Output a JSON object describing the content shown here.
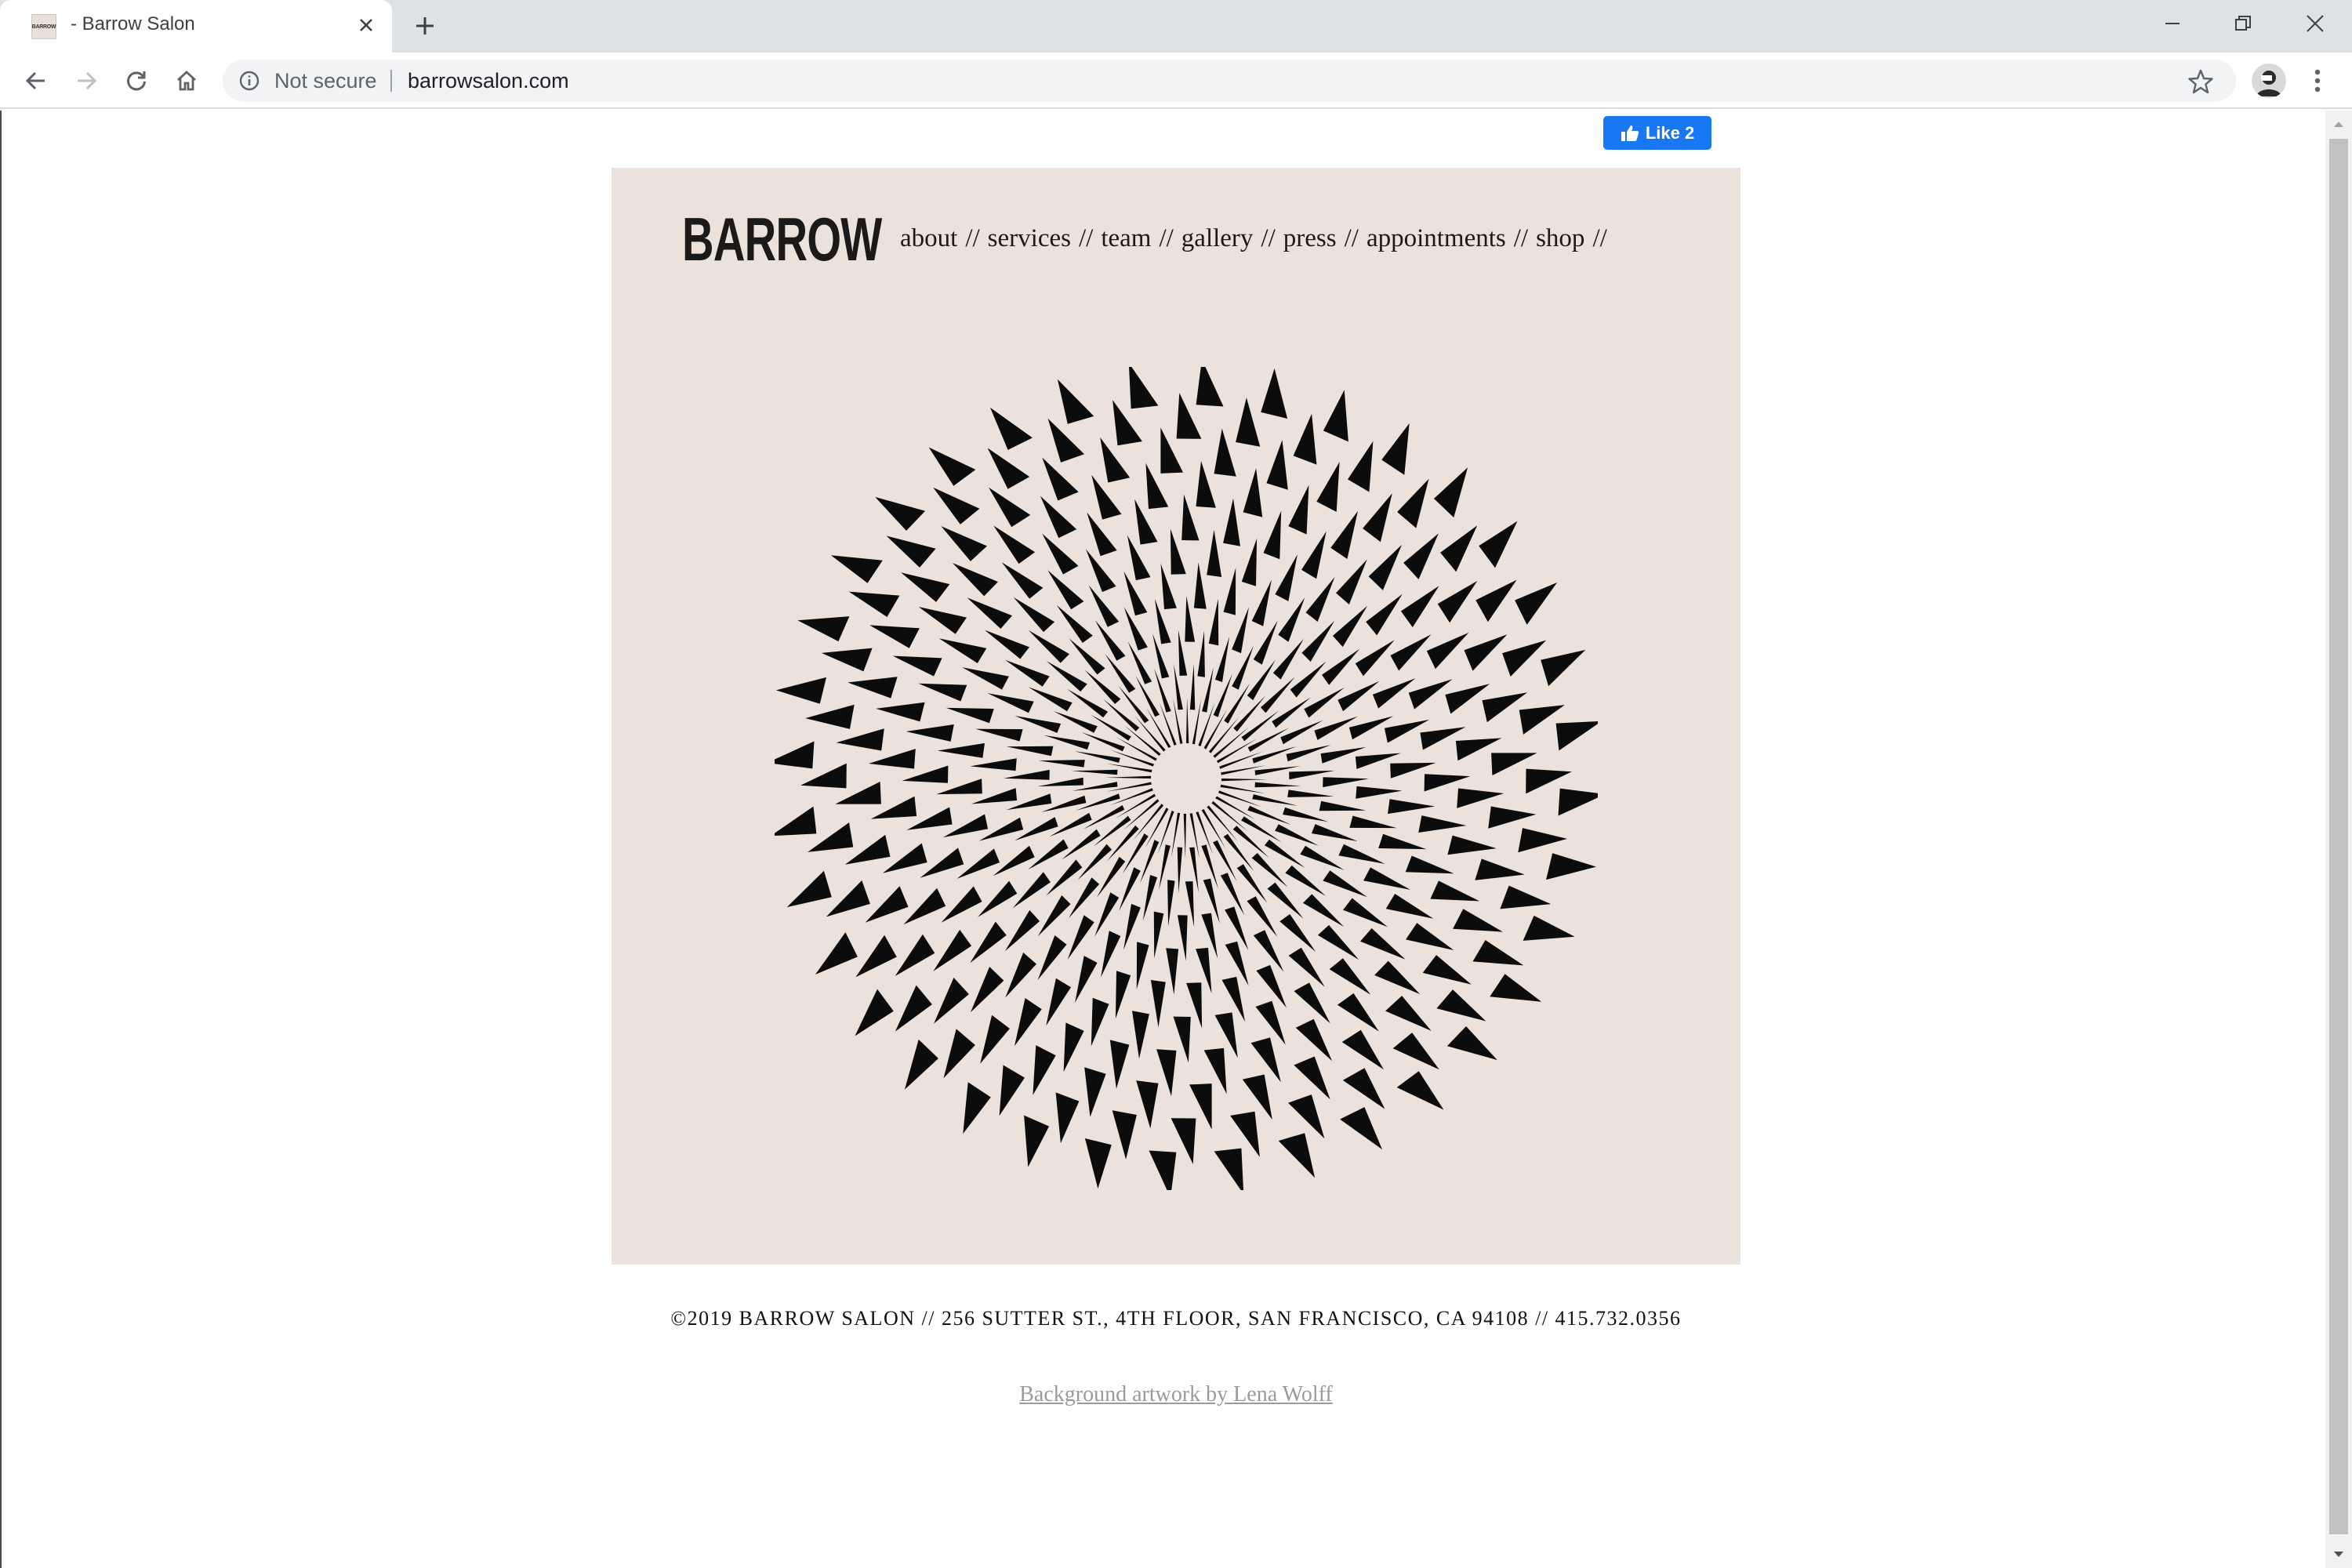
{
  "browser": {
    "tab": {
      "title": "- Barrow Salon",
      "favicon_text": "BARROW"
    },
    "address_bar": {
      "security_label": "Not secure",
      "url": "barrowsalon.com"
    },
    "icons": [
      "back-icon",
      "forward-icon",
      "reload-icon",
      "home-icon",
      "info-icon",
      "star-icon",
      "profile-avatar",
      "menu-icon",
      "minimize-icon",
      "restore-icon",
      "close-window-icon"
    ]
  },
  "facebook": {
    "like_label": "Like 2",
    "color": "#1877f2"
  },
  "site": {
    "logo": "BARROW",
    "nav": [
      {
        "label": "about",
        "sep": "//"
      },
      {
        "label": "services",
        "sep": "//"
      },
      {
        "label": "team",
        "sep": "//"
      },
      {
        "label": "gallery",
        "sep": "//"
      },
      {
        "label": "press",
        "sep": "//"
      },
      {
        "label": "appointments",
        "sep": "//"
      },
      {
        "label": "shop",
        "sep": "//"
      }
    ],
    "hero_background": "#ebe3db",
    "footer": {
      "address": "©2019 BARROW SALON // 256 SUTTER ST., 4TH FLOOR, SAN FRANCISCO, CA 94108 // 415.732.0356",
      "credit": "Background artwork by Lena Wolff"
    }
  }
}
